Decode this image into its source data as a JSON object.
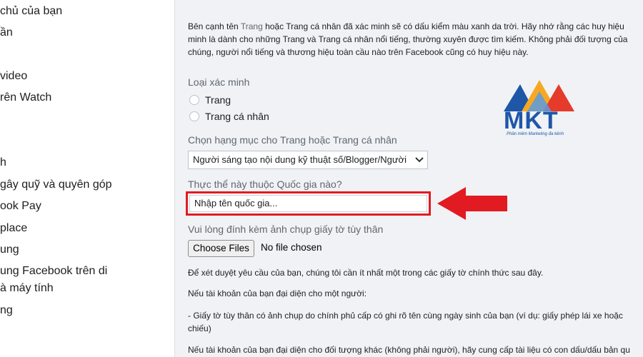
{
  "sidebar": {
    "items": [
      {
        "label": "chủ của bạn"
      },
      {
        "label": "ần"
      },
      {
        "label": " video"
      },
      {
        "label": "rên Watch"
      },
      {
        "label": "h"
      },
      {
        "label": "gây quỹ và quyên góp"
      },
      {
        "label": "ook Pay"
      },
      {
        "label": "place"
      },
      {
        "label": "ung"
      },
      {
        "label": "ung Facebook trên di"
      },
      {
        "label": "à máy tính"
      },
      {
        "label": "ng"
      }
    ]
  },
  "main": {
    "intro": {
      "line1_before": "Bên cạnh tên ",
      "line1_link": "Trang",
      "line1_after": " hoặc Trang cá nhân đã xác minh sẽ có dấu kiểm màu xanh da trời. Hãy nhớ rằng các huy hiệu",
      "line2": "minh là dành cho những Trang và Trang cá nhân nổi tiếng, thường xuyên được tìm kiếm. Không phải đối tượng của",
      "line3": "chúng, người nổi tiếng và thương hiệu toàn cầu nào trên Facebook cũng có huy hiệu này."
    },
    "verification_type": {
      "label": "Loại xác minh",
      "options": [
        {
          "label": "Trang"
        },
        {
          "label": "Trang cá nhân"
        }
      ]
    },
    "category": {
      "label": "Chọn hạng mục cho Trang hoặc Trang cá nhân",
      "selected": "Người sáng tạo nội dung kỹ thuật số/Blogger/Người"
    },
    "country": {
      "label": "Thực thể này thuộc Quốc gia nào?",
      "placeholder": "Nhập tên quốc gia..."
    },
    "id_upload": {
      "label": "Vui lòng đính kèm ảnh chụp giấy tờ tùy thân",
      "button": "Choose Files",
      "status": "No file chosen"
    },
    "notes": {
      "line1": "Để xét duyệt yêu cầu của bạn, chúng tôi cần ít nhất một trong các giấy tờ chính thức sau đây.",
      "line2": "Nếu tài khoản của bạn đại diện cho một người:",
      "line3a": "- Giấy tờ tùy thân có ảnh chụp do chính phủ cấp có ghi rõ tên cùng ngày sinh của bạn (ví dụ: giấy phép lái xe hoặc",
      "line3b": "chiếu)",
      "line4": "Nếu tài khoản của bạn đại diện cho đối tượng khác (không phải người), hãy cung cấp tài liệu có con dấu/dấu bản qu"
    }
  },
  "overlay": {
    "logo_text": "MKT",
    "logo_tagline": "Phần mềm Marketing đa kênh",
    "arrow_color": "#e21a22",
    "highlight_color": "#e21a22",
    "logo_colors": [
      "#1e56a8",
      "#f7a823",
      "#e63a2b",
      "#5a9be0"
    ]
  }
}
